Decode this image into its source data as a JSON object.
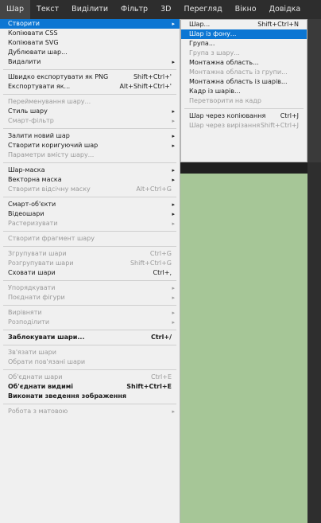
{
  "menubar": {
    "items": [
      "Шар",
      "Текст",
      "Виділити",
      "Фільтр",
      "3D",
      "Перегляд",
      "Вікно",
      "Довідка"
    ]
  },
  "layer_menu": {
    "items": [
      {
        "label": "Створити",
        "arrow": true,
        "highlight": true
      },
      {
        "label": "Копіювати CSS"
      },
      {
        "label": "Копіювати SVG"
      },
      {
        "label": "Дублювати шар..."
      },
      {
        "label": "Видалити",
        "arrow": true
      },
      {
        "sep": true
      },
      {
        "label": "Швидко експортувати як PNG",
        "shortcut": "Shift+Ctrl+'"
      },
      {
        "label": "Експортувати як...",
        "shortcut": "Alt+Shift+Ctrl+'"
      },
      {
        "sep": true
      },
      {
        "label": "Перейменування шару...",
        "disabled": true
      },
      {
        "label": "Стиль шару",
        "arrow": true
      },
      {
        "label": "Смарт-фільтр",
        "arrow": true,
        "disabled": true
      },
      {
        "sep": true
      },
      {
        "label": "Залити новий шар",
        "arrow": true
      },
      {
        "label": "Створити коригуючий шар",
        "arrow": true
      },
      {
        "label": "Параметри вмісту шару...",
        "disabled": true
      },
      {
        "sep": true
      },
      {
        "label": "Шар-маска",
        "arrow": true
      },
      {
        "label": "Векторна маска",
        "arrow": true
      },
      {
        "label": "Створити відсічну маску",
        "shortcut": "Alt+Ctrl+G",
        "disabled": true
      },
      {
        "sep": true
      },
      {
        "label": "Смарт-об'єкти",
        "arrow": true
      },
      {
        "label": "Відеошари",
        "arrow": true
      },
      {
        "label": "Растеризувати",
        "arrow": true,
        "disabled": true
      },
      {
        "sep": true
      },
      {
        "label": "Створити фрагмент шару",
        "disabled": true
      },
      {
        "sep": true
      },
      {
        "label": "Згрупувати шари",
        "shortcut": "Ctrl+G",
        "disabled": true
      },
      {
        "label": "Розгрупувати шари",
        "shortcut": "Shift+Ctrl+G",
        "disabled": true
      },
      {
        "label": "Сховати шари",
        "shortcut": "Ctrl+,"
      },
      {
        "sep": true
      },
      {
        "label": "Упорядкувати",
        "arrow": true,
        "disabled": true
      },
      {
        "label": "Поєднати фігури",
        "arrow": true,
        "disabled": true
      },
      {
        "sep": true
      },
      {
        "label": "Вирівняти",
        "arrow": true,
        "disabled": true
      },
      {
        "label": "Розподілити",
        "arrow": true,
        "disabled": true
      },
      {
        "sep": true
      },
      {
        "label": "Заблокувати шари...",
        "shortcut": "Ctrl+/",
        "bold": true
      },
      {
        "sep": true
      },
      {
        "label": "Зв'язати шари",
        "disabled": true
      },
      {
        "label": "Обрати пов'язані шари",
        "disabled": true
      },
      {
        "sep": true
      },
      {
        "label": "Об'єднати шари",
        "shortcut": "Ctrl+E",
        "disabled": true
      },
      {
        "label": "Об'єднати видимі",
        "shortcut": "Shift+Ctrl+E",
        "bold": true
      },
      {
        "label": "Виконати зведення зображення",
        "bold": true
      },
      {
        "sep": true
      },
      {
        "label": "Робота з матовою",
        "arrow": true,
        "disabled": true
      }
    ]
  },
  "new_submenu": {
    "items": [
      {
        "label": "Шар...",
        "shortcut": "Shift+Ctrl+N"
      },
      {
        "label": "Шар із фону...",
        "highlight": true
      },
      {
        "label": "Група..."
      },
      {
        "label": "Група з шару...",
        "disabled": true
      },
      {
        "label": "Монтажна область..."
      },
      {
        "label": "Монтажна область із групи...",
        "disabled": true
      },
      {
        "label": "Монтажна область із шарів..."
      },
      {
        "label": "Кадр із шарів..."
      },
      {
        "label": "Перетворити на кадр",
        "disabled": true
      },
      {
        "sep": true
      },
      {
        "label": "Шар через копіювання",
        "shortcut": "Ctrl+J"
      },
      {
        "label": "Шар через вирізання",
        "shortcut": "Shift+Ctrl+J",
        "disabled": true
      }
    ]
  }
}
